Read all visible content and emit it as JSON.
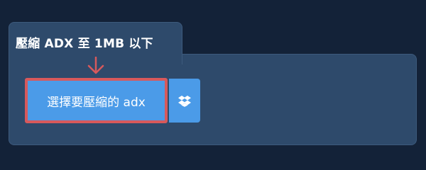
{
  "panel": {
    "title": "壓縮 ADX 至 1MB 以下"
  },
  "upload": {
    "button_label": "選擇要壓縮的 adx",
    "dropbox_icon": "dropbox-icon",
    "arrow_icon": "arrow-down-icon"
  },
  "colors": {
    "background": "#132238",
    "panel": "#2e4a6b",
    "button": "#4b9be8",
    "highlight": "#d7595c"
  }
}
